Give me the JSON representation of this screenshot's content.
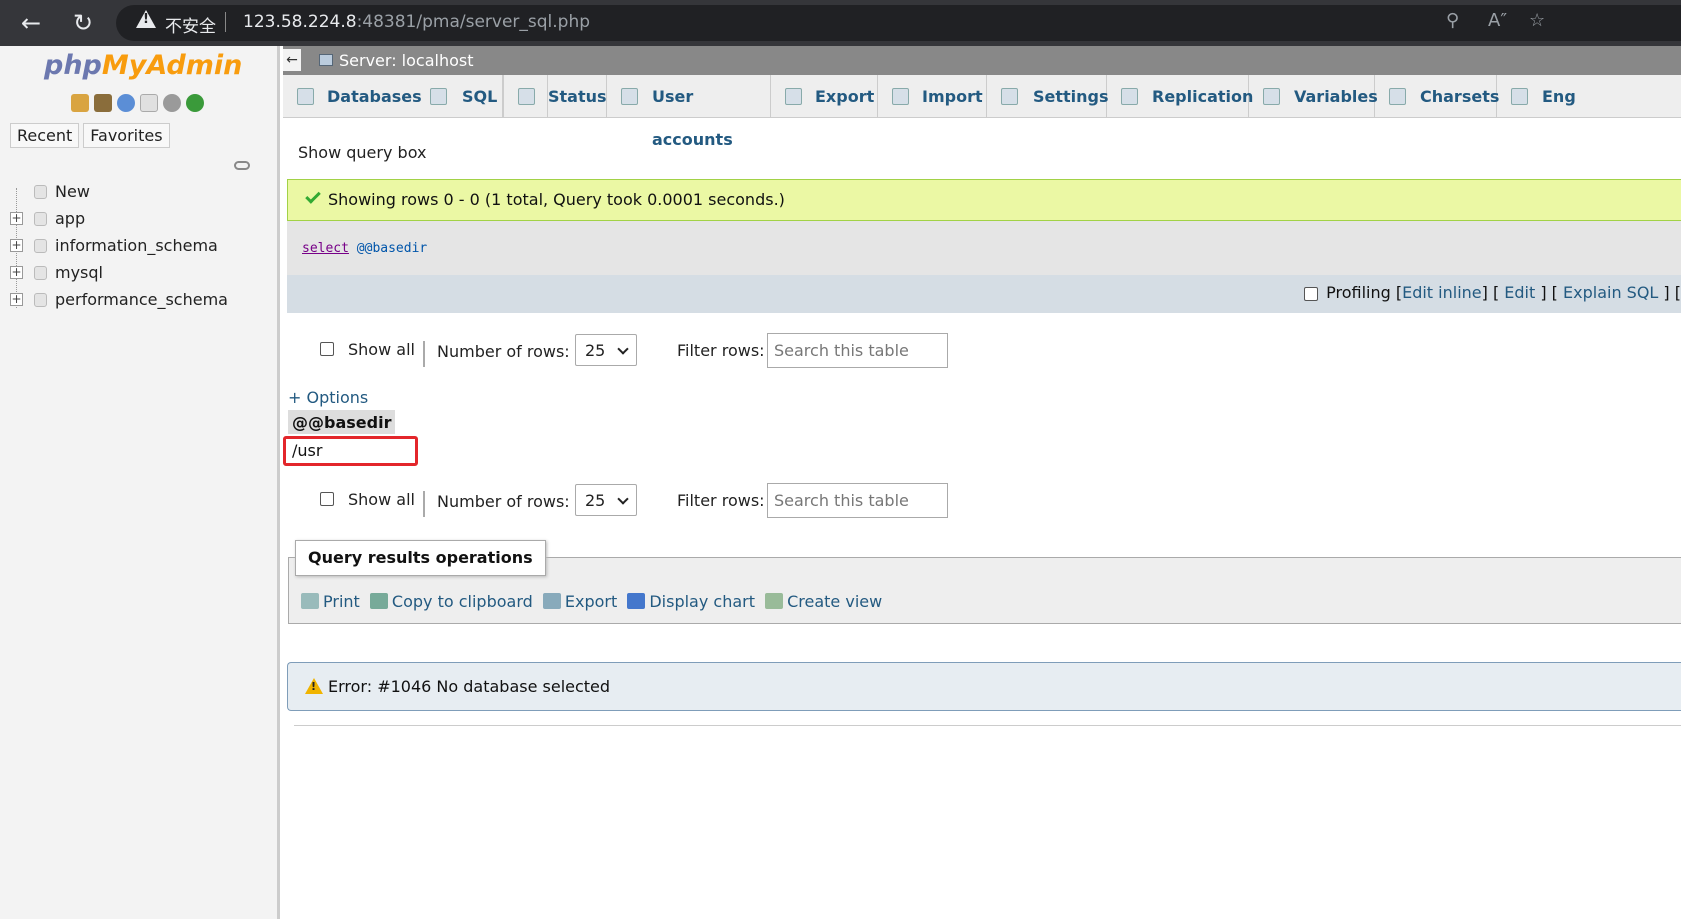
{
  "browser": {
    "insecure_label": "不安全",
    "url_host": "123.58.224.8",
    "url_rest": ":48381/pma/server_sql.php"
  },
  "sidebar": {
    "logo_php": "php",
    "logo_myadmin": "MyAdmin",
    "tabs": [
      "Recent",
      "Favorites"
    ],
    "tree": [
      "New",
      "app",
      "information_schema",
      "mysql",
      "performance_schema"
    ]
  },
  "server_bar": {
    "title": "Server: localhost"
  },
  "tabs": [
    "Databases",
    "SQL",
    "Status",
    "User accounts",
    "Export",
    "Import",
    "Settings",
    "Replication",
    "Variables",
    "Charsets",
    "Eng"
  ],
  "query": {
    "show_query_box": "Show query box",
    "success_message": "Showing rows 0 - 0 (1 total, Query took 0.0001 seconds.)",
    "sql_keyword": "select",
    "sql_variable": "@@basedir",
    "profiling_label": "Profiling",
    "edit_inline": "Edit inline",
    "edit": "Edit",
    "explain_sql": "Explain SQL"
  },
  "navigation": {
    "show_all": "Show all",
    "rows_label": "Number of rows:",
    "rows_value": "25",
    "filter_label": "Filter rows:",
    "filter_placeholder": "Search this table"
  },
  "results": {
    "options_link": "+ Options",
    "column_header": "@@basedir",
    "cell_value": "/usr"
  },
  "operations": {
    "legend": "Query results operations",
    "links": [
      "Print",
      "Copy to clipboard",
      "Export",
      "Display chart",
      "Create view"
    ]
  },
  "error": {
    "message": "Error: #1046 No database selected"
  },
  "colors": {
    "accent_link": "#235a81",
    "success_bg": "#ebf8a4",
    "highlight_border": "#e3262b",
    "logo_php": "#6c78af",
    "logo_myadmin": "#f89c0e"
  }
}
